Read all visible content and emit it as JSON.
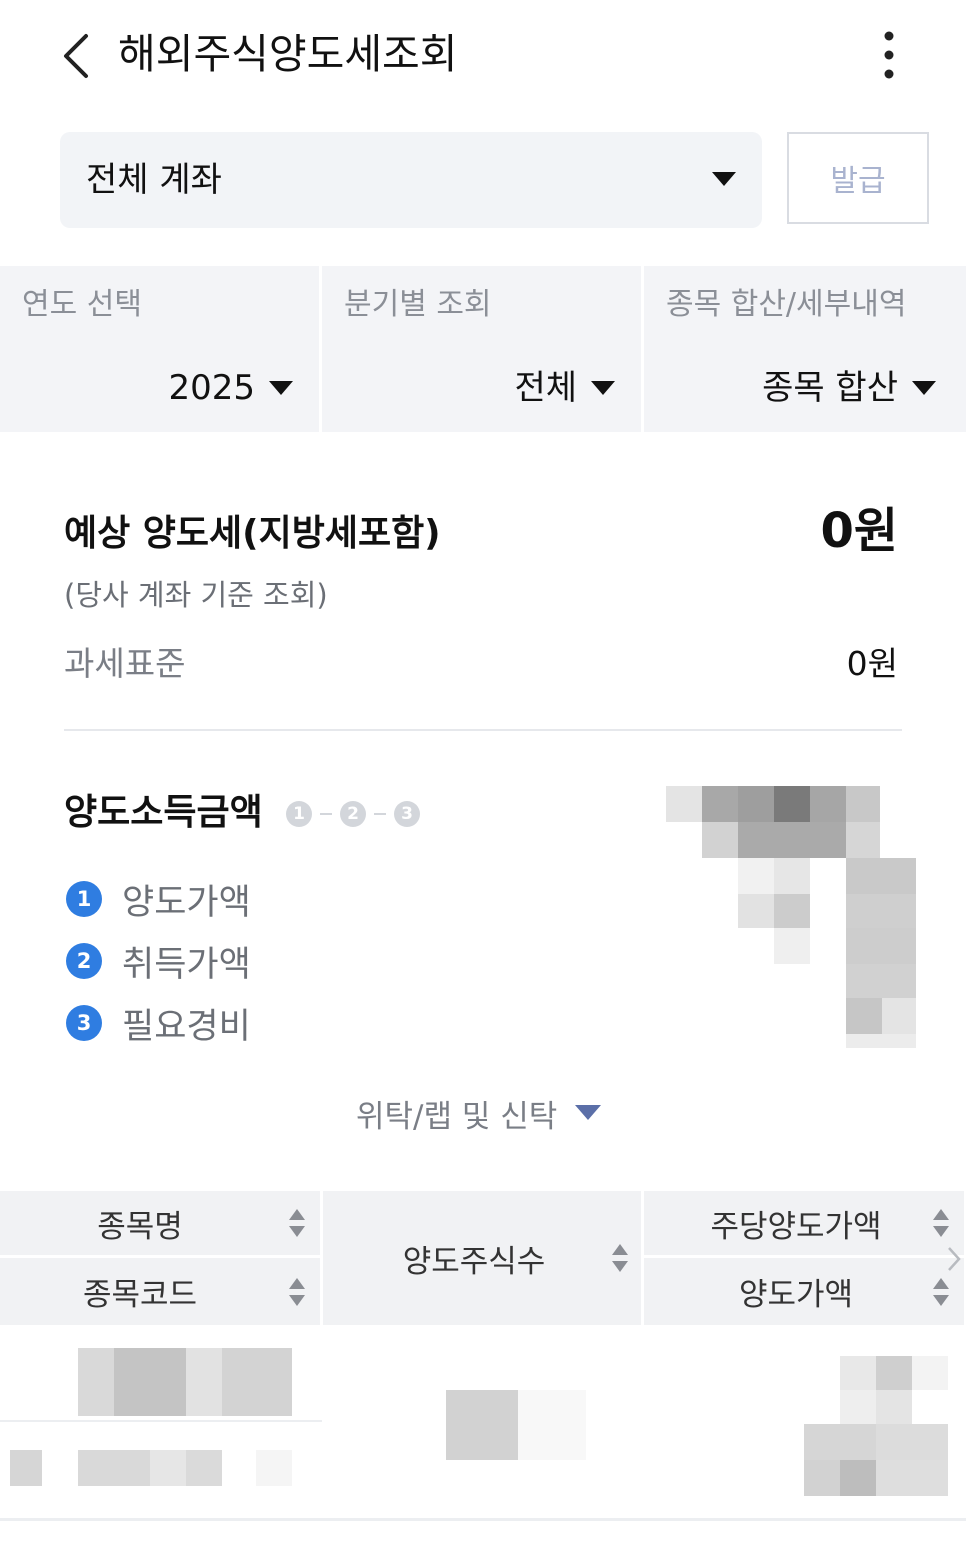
{
  "header": {
    "title": "해외주식양도세조회",
    "back_icon": "chevron-left-icon",
    "menu_icon": "more-vertical-icon"
  },
  "account": {
    "selected": "전체 계좌",
    "issue_label": "발급"
  },
  "filters": [
    {
      "title": "연도 선택",
      "value": "2025"
    },
    {
      "title": "분기별 조회",
      "value": "전체"
    },
    {
      "title": "종목 합산/세부내역",
      "value": "종목 합산"
    }
  ],
  "summary": {
    "estimated_label": "예상 양도세(지방세포함)",
    "estimated_value": "0원",
    "note": "(당사 계좌 기준 조회)",
    "tax_base_label": "과세표준",
    "tax_base_value": "0원"
  },
  "capital_gain": {
    "title": "양도소득금액",
    "formula": [
      "1",
      "2",
      "3"
    ],
    "items": [
      {
        "num": "1",
        "label": "양도가액"
      },
      {
        "num": "2",
        "label": "취득가액"
      },
      {
        "num": "3",
        "label": "필요경비"
      }
    ]
  },
  "trust": {
    "label": "위탁/랩 및 신탁"
  },
  "table": {
    "headers": {
      "name": "종목명",
      "code": "종목코드",
      "quantity": "양도주식수",
      "price_per_share": "주당양도가액",
      "sale_amount": "양도가액"
    }
  },
  "colors": {
    "accent": "#2f7de1",
    "panel": "#f3f4f7",
    "muted_text": "#7a7e86"
  }
}
